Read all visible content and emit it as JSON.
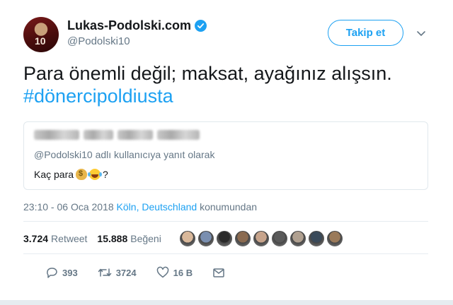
{
  "author": {
    "display_name": "Lukas-Podolski.com",
    "handle": "@Podolski10",
    "avatar_text": "10"
  },
  "follow_button": {
    "label": "Takip et"
  },
  "tweet": {
    "text": "Para önemli değil; maksat, ayağınız alışsın.",
    "hashtag": "#dönercipoldiusta"
  },
  "quoted_tweet": {
    "reply_to": "@Podolski10 adlı kullanıcıya yanıt olarak",
    "text_prefix": "Kaç para",
    "text_suffix": "?",
    "emojis": [
      "money-bag",
      "tears-of-joy"
    ]
  },
  "meta": {
    "time": "23:10 - 06 Oca 2018",
    "location": "Köln, Deutschland",
    "location_suffix": "konumundan"
  },
  "stats": {
    "retweets_count": "3.724",
    "retweets_label": "Retweet",
    "likes_count": "15.888",
    "likes_label": "Beğeni",
    "liker_avatar_colors": [
      "#d9b89a",
      "#7a8fb0",
      "#2a2a2a",
      "#8a6a50",
      "#c7a48c",
      "#5a5a5a",
      "#b0a090",
      "#3a4a5a",
      "#9a7a5a"
    ]
  },
  "actions": {
    "reply_count": "393",
    "retweet_count": "3724",
    "like_count": "16 B"
  },
  "colors": {
    "accent": "#1da1f2",
    "text": "#14171a",
    "secondary": "#657786"
  }
}
